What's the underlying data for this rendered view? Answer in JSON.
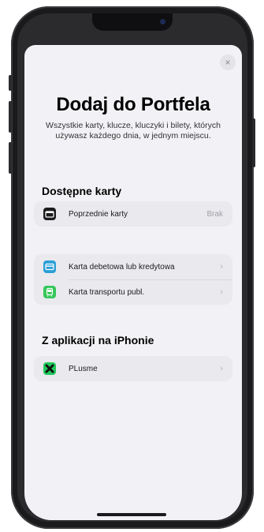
{
  "sheet": {
    "close_glyph": "×",
    "title": "Dodaj do Portfela",
    "subtitle": "Wszystkie karty, klucze, kluczyki i bilety, których używasz każdego dnia, w jednym miejscu."
  },
  "sections": [
    {
      "title": "Dostępne karty",
      "rows": [
        {
          "icon": "wallet-icon",
          "icon_color": "#1c1c1e",
          "label": "Poprzednie karty",
          "value": "Brak"
        }
      ]
    },
    {
      "title": "",
      "rows": [
        {
          "icon": "credit-card-icon",
          "icon_color": "#2a9fd8",
          "label": "Karta debetowa lub kredytowa",
          "chevron": "›"
        },
        {
          "icon": "transit-card-icon",
          "icon_color": "#34c759",
          "label": "Karta transportu publ.",
          "chevron": "›"
        }
      ]
    },
    {
      "title": "Z aplikacji na iPhonie",
      "rows": [
        {
          "icon": "plusme-app-icon",
          "icon_color": "#1fc85a",
          "label": "PLusme",
          "chevron": "›"
        }
      ]
    }
  ]
}
